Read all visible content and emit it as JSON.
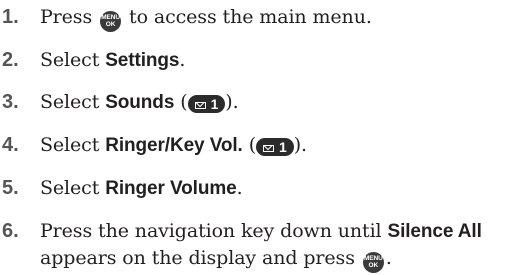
{
  "steps": [
    {
      "number": "1.",
      "before": "Press",
      "after": "to access the main menu.",
      "key": {
        "line1": "MENU",
        "line2": "OK"
      }
    },
    {
      "number": "2.",
      "before": "Select",
      "keyword": "Settings",
      "after": "."
    },
    {
      "number": "3.",
      "before": "Select",
      "keyword": "Sounds",
      "open": "(",
      "shortcut": "1",
      "close": ")."
    },
    {
      "number": "4.",
      "before": "Select",
      "keyword": "Ringer/Key Vol.",
      "open": "(",
      "shortcut": "1",
      "close": ")."
    },
    {
      "number": "5.",
      "before": "Select",
      "keyword": "Ringer Volume",
      "after": "."
    },
    {
      "number": "6.",
      "before": "Press the navigation key down until",
      "keyword": "Silence All",
      "line2_before": "appears on the display and press",
      "line2_after": ".",
      "key": {
        "line1": "MENU",
        "line2": "OK"
      }
    }
  ],
  "icons": {
    "menu_key": "menu-ok-key-icon",
    "shortcut": "envelope-icon"
  },
  "colors": {
    "text": "#231f20",
    "number": "#555555",
    "key_bg": "#3a3a3a"
  }
}
